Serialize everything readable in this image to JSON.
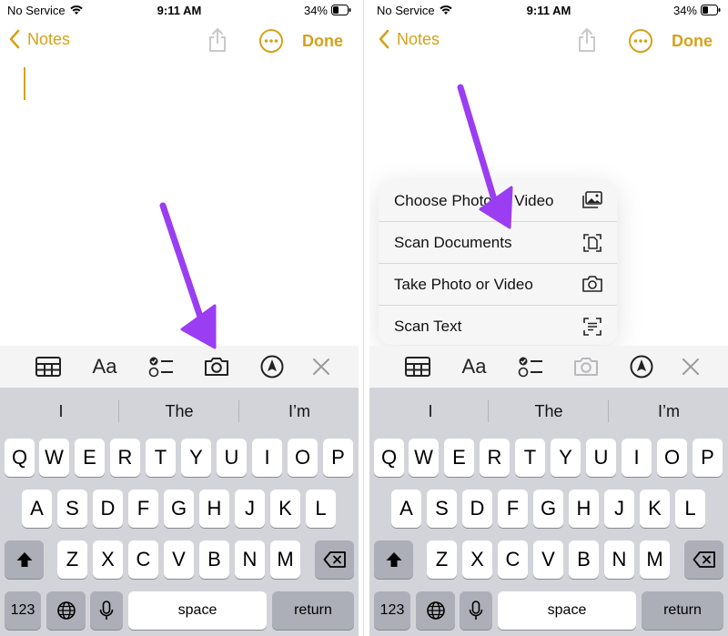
{
  "status_bar": {
    "carrier": "No Service",
    "time": "9:11 AM",
    "battery": "34%"
  },
  "nav": {
    "back_label": "Notes",
    "done_label": "Done"
  },
  "toolbar": {
    "icons": [
      "table-icon",
      "text-format-icon",
      "checklist-icon",
      "camera-icon",
      "markup-pen-icon",
      "close-icon"
    ],
    "format_label": "Aa"
  },
  "suggestions": [
    "I",
    "The",
    "I’m"
  ],
  "keyboard": {
    "row1": [
      "Q",
      "W",
      "E",
      "R",
      "T",
      "Y",
      "U",
      "I",
      "O",
      "P"
    ],
    "row2": [
      "A",
      "S",
      "D",
      "F",
      "G",
      "H",
      "J",
      "K",
      "L"
    ],
    "row3": [
      "Z",
      "X",
      "C",
      "V",
      "B",
      "N",
      "M"
    ],
    "numbers_label": "123",
    "space_label": "space",
    "return_label": "return"
  },
  "camera_menu": {
    "items": [
      {
        "label": "Choose Photo or Video",
        "icon": "photo-library-icon"
      },
      {
        "label": "Scan Documents",
        "icon": "scan-documents-icon"
      },
      {
        "label": "Take Photo or Video",
        "icon": "camera-icon"
      },
      {
        "label": "Scan Text",
        "icon": "scan-text-icon"
      }
    ]
  },
  "colors": {
    "accent": "#d4a21b",
    "arrow": "#9b3df2",
    "keyboard_bg": "#d3d4d9",
    "toolbar_bg": "#f4f4f5"
  }
}
